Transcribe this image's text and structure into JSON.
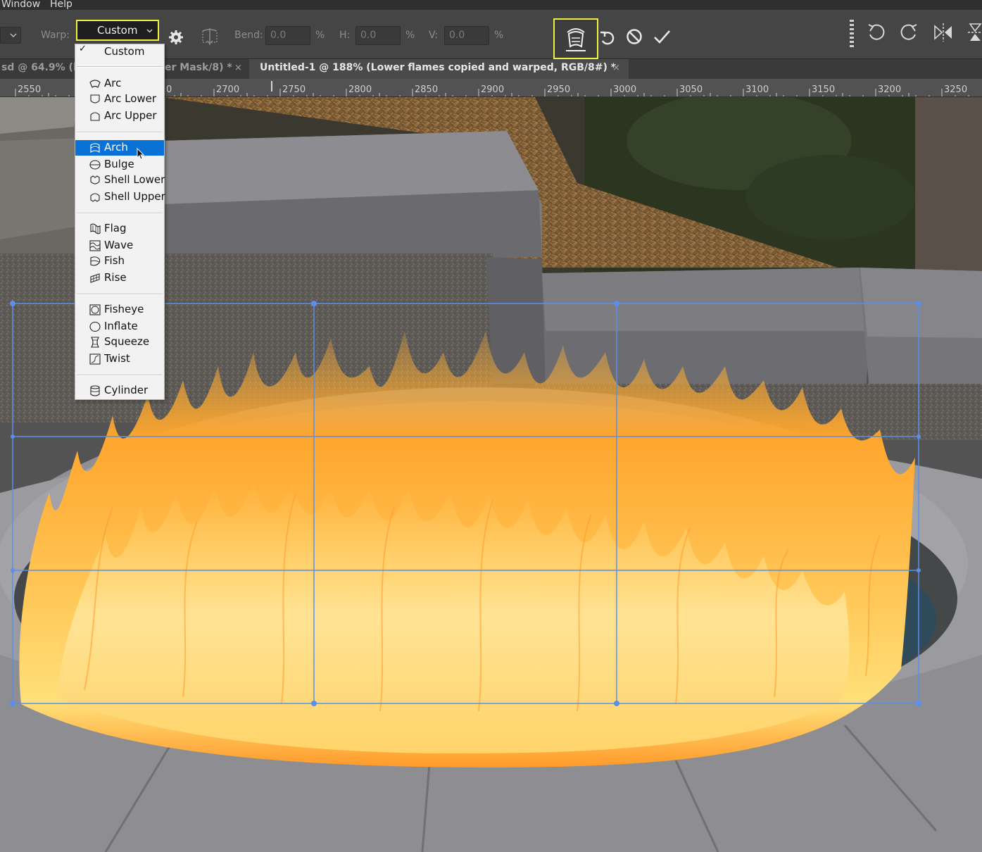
{
  "menubar": {
    "items": [
      "Window",
      "Help"
    ]
  },
  "options": {
    "warp_label": "Warp:",
    "warp_value": "Custom",
    "bend_label": "Bend:",
    "bend_value": "0.0",
    "h_label": "H:",
    "h_value": "0.0",
    "v_label": "V:",
    "v_value": "0.0",
    "percent": "%"
  },
  "tabs": [
    {
      "label": "sd @ 64.9% (k",
      "active": false
    },
    {
      "label": "er Mask/8) *",
      "active": false
    },
    {
      "label": "Untitled-1 @ 188% (Lower flames copied and warped, RGB/8#) *",
      "active": true
    }
  ],
  "tab_close": "×",
  "ruler": {
    "labels": [
      "2550",
      "0",
      "2700",
      "2750",
      "2800",
      "2850",
      "2900",
      "2950",
      "3000",
      "3050",
      "3100",
      "3150",
      "3200",
      "3250"
    ]
  },
  "warp_menu": {
    "check": "✓",
    "items": [
      {
        "label": "Custom",
        "icon": "checkmark",
        "selected": false
      },
      {
        "label": "Arc",
        "icon": "arc-icon",
        "selected": false
      },
      {
        "label": "Arc Lower",
        "icon": "arc-lower-icon",
        "selected": false
      },
      {
        "label": "Arc Upper",
        "icon": "arc-upper-icon",
        "selected": false
      },
      {
        "label": "Arch",
        "icon": "arch-icon",
        "selected": true
      },
      {
        "label": "Bulge",
        "icon": "bulge-icon",
        "selected": false
      },
      {
        "label": "Shell Lower",
        "icon": "shell-lower-icon",
        "selected": false
      },
      {
        "label": "Shell Upper",
        "icon": "shell-upper-icon",
        "selected": false
      },
      {
        "label": "Flag",
        "icon": "flag-icon",
        "selected": false
      },
      {
        "label": "Wave",
        "icon": "wave-icon",
        "selected": false
      },
      {
        "label": "Fish",
        "icon": "fish-icon",
        "selected": false
      },
      {
        "label": "Rise",
        "icon": "rise-icon",
        "selected": false
      },
      {
        "label": "Fisheye",
        "icon": "fisheye-icon",
        "selected": false
      },
      {
        "label": "Inflate",
        "icon": "inflate-icon",
        "selected": false
      },
      {
        "label": "Squeeze",
        "icon": "squeeze-icon",
        "selected": false
      },
      {
        "label": "Twist",
        "icon": "twist-icon",
        "selected": false
      },
      {
        "label": "Cylinder",
        "icon": "cylinder-icon",
        "selected": false
      }
    ]
  },
  "colors": {
    "highlight_outline": "#f1ee3c",
    "menu_selection": "#0a72d6",
    "warp_grid": "#5b8fe8"
  }
}
